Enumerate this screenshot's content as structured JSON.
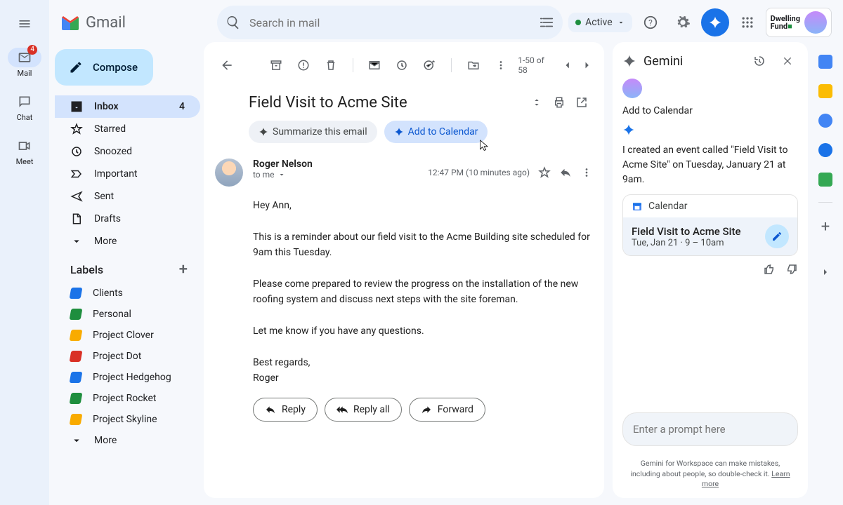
{
  "header": {
    "logo_text": "Gmail",
    "search_placeholder": "Search in mail",
    "status": "Active",
    "org": "Dwelling Fund"
  },
  "rail": {
    "mail": "Mail",
    "mail_badge": "4",
    "chat": "Chat",
    "meet": "Meet"
  },
  "compose": "Compose",
  "nav": {
    "inbox": "Inbox",
    "inbox_count": "4",
    "starred": "Starred",
    "snoozed": "Snoozed",
    "important": "Important",
    "sent": "Sent",
    "drafts": "Drafts",
    "more": "More"
  },
  "labels_header": "Labels",
  "labels": [
    {
      "name": "Clients",
      "color": "#1a73e8"
    },
    {
      "name": "Personal",
      "color": "#1e8e3e"
    },
    {
      "name": "Project Clover",
      "color": "#f9ab00"
    },
    {
      "name": "Project Dot",
      "color": "#d93025"
    },
    {
      "name": "Project Hedgehog",
      "color": "#1a73e8"
    },
    {
      "name": "Project Rocket",
      "color": "#1e8e3e"
    },
    {
      "name": "Project Skyline",
      "color": "#f9ab00"
    }
  ],
  "labels_more": "More",
  "toolbar": {
    "pager": "1-50 of 58"
  },
  "message": {
    "subject": "Field Visit to Acme Site",
    "chip_summarize": "Summarize this email",
    "chip_add_calendar": "Add to Calendar",
    "sender": "Roger Nelson",
    "recipient": "to me",
    "time": "12:47 PM (10 minutes ago)",
    "body": "Hey Ann,\n\nThis is a reminder about our field visit to the Acme Building site scheduled for 9am this Tuesday.\n\nPlease come prepared to review the progress on the installation of the new roofing system and discuss next steps with the site foreman.\n\nLet me know if you have any questions.\n\nBest regards,\nRoger",
    "reply": "Reply",
    "reply_all": "Reply all",
    "forward": "Forward"
  },
  "gemini": {
    "title": "Gemini",
    "context": "Add to Calendar",
    "response": "I created an event called \"Field Visit to Acme Site\" on Tuesday, January 21 at 9am.",
    "card_app": "Calendar",
    "event_title": "Field Visit to Acme Site",
    "event_time": "Tue, Jan 21 · 9 – 10am",
    "prompt_placeholder": "Enter a prompt here",
    "disclaimer_pre": "Gemini for Workspace can make mistakes, including about people, so double-check it. ",
    "disclaimer_link": "Learn more"
  }
}
